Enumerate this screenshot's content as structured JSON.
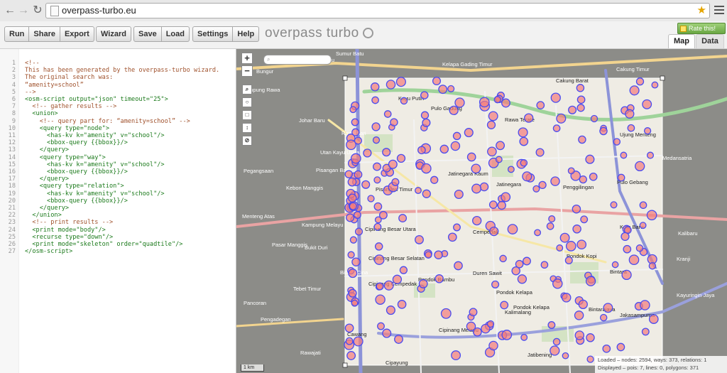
{
  "browser": {
    "url": "overpass-turbo.eu"
  },
  "toolbar": {
    "run": "Run",
    "share": "Share",
    "export": "Export",
    "wizard": "Wizard",
    "save": "Save",
    "load": "Load",
    "settings": "Settings",
    "help": "Help",
    "title": "overpass turbo",
    "rate": "Rate this!",
    "tab_map": "Map",
    "tab_data": "Data"
  },
  "editor": {
    "lines": [
      {
        "n": "1",
        "t": "<!--",
        "k": "comment"
      },
      {
        "n": "2",
        "t": "This has been generated by the overpass-turbo wizard.",
        "k": "comment"
      },
      {
        "n": "3",
        "t": "The original search was:",
        "k": "comment"
      },
      {
        "n": "4",
        "t": "“amenity=school”",
        "k": "comment"
      },
      {
        "n": "5",
        "t": "-->",
        "k": "comment"
      },
      {
        "n": "6",
        "t": "<osm-script output=\"json\" timeout=\"25\">",
        "k": "tag"
      },
      {
        "n": "7",
        "t": "  <!-- gather results -->",
        "k": "comment"
      },
      {
        "n": "8",
        "t": "  <union>",
        "k": "tag"
      },
      {
        "n": "9",
        "t": "    <!-- query part for: “amenity=school” -->",
        "k": "comment"
      },
      {
        "n": "10",
        "t": "    <query type=\"node\">",
        "k": "tag"
      },
      {
        "n": "11",
        "t": "      <has-kv k=\"amenity\" v=\"school\"/>",
        "k": "tag"
      },
      {
        "n": "12",
        "t": "      <bbox-query {{bbox}}/>",
        "k": "tag"
      },
      {
        "n": "13",
        "t": "    </query>",
        "k": "tag"
      },
      {
        "n": "14",
        "t": "    <query type=\"way\">",
        "k": "tag"
      },
      {
        "n": "15",
        "t": "      <has-kv k=\"amenity\" v=\"school\"/>",
        "k": "tag"
      },
      {
        "n": "16",
        "t": "      <bbox-query {{bbox}}/>",
        "k": "tag"
      },
      {
        "n": "17",
        "t": "    </query>",
        "k": "tag"
      },
      {
        "n": "18",
        "t": "    <query type=\"relation\">",
        "k": "tag"
      },
      {
        "n": "19",
        "t": "      <has-kv k=\"amenity\" v=\"school\"/>",
        "k": "tag"
      },
      {
        "n": "20",
        "t": "      <bbox-query {{bbox}}/>",
        "k": "tag"
      },
      {
        "n": "21",
        "t": "    </query>",
        "k": "tag"
      },
      {
        "n": "22",
        "t": "  </union>",
        "k": "tag"
      },
      {
        "n": "23",
        "t": "  <!-- print results -->",
        "k": "comment"
      },
      {
        "n": "24",
        "t": "  <print mode=\"body\"/>",
        "k": "tag"
      },
      {
        "n": "25",
        "t": "  <recurse type=\"down\"/>",
        "k": "tag"
      },
      {
        "n": "26",
        "t": "  <print mode=\"skeleton\" order=\"quadtile\"/>",
        "k": "tag"
      },
      {
        "n": "27",
        "t": "</osm-script>",
        "k": "tag"
      }
    ]
  },
  "map": {
    "scale": "1 km",
    "stats_loaded": "Loaded – nodes: 2594, ways: 373, relations: 1",
    "stats_displayed": "Displayed – pois: 7, lines: 0, polygons: 371",
    "marker_fill": "#f47c7c",
    "marker_stroke": "#4a4cf0",
    "labels": [
      "Sumur Batu",
      "Cempaka Baru",
      "Kelapa Gading Timur",
      "Cakung Timur",
      "Bungur",
      "Kayu Putih",
      "Pulo Gadung",
      "Cakung Barat",
      "Kampung Rawa",
      "Johar Baru",
      "Rawa Sari",
      "Rawa Terate",
      "Ujung Menteng",
      "Utan Kayu Utara",
      "Medansatria",
      "Pegangsaan",
      "Pisangan Baru",
      "Jatinegara Kaum",
      "Jatinegara",
      "Pulo Gebang",
      "Kebon Manggis",
      "Pisangan Timur",
      "Penggilingan",
      "Menteng Atas",
      "Kampung Melayu",
      "Pasar Manggis",
      "Cipinang Besar Utara",
      "Cempedak",
      "Kota Baru",
      "Kalibaru",
      "Bukit Duri",
      "Cipinang Besar Selatan",
      "Pondok Kopi",
      "Kranji",
      "Bidara Cina",
      "Cipinang Cempedak",
      "Pondok Bambu",
      "Duren Sawit",
      "Bintara",
      "Tebet Timur",
      "Kayuringin Jaya",
      "Pancoran",
      "Pondok Kelapa",
      "Jakasampurna",
      "Pengadegan",
      "Bintarajaya",
      "Cawang",
      "Cipinang Melayu",
      "Kalimalang",
      "Rawajati",
      "Jatibening",
      "Cipayung",
      "Pondok Kelapa"
    ]
  }
}
